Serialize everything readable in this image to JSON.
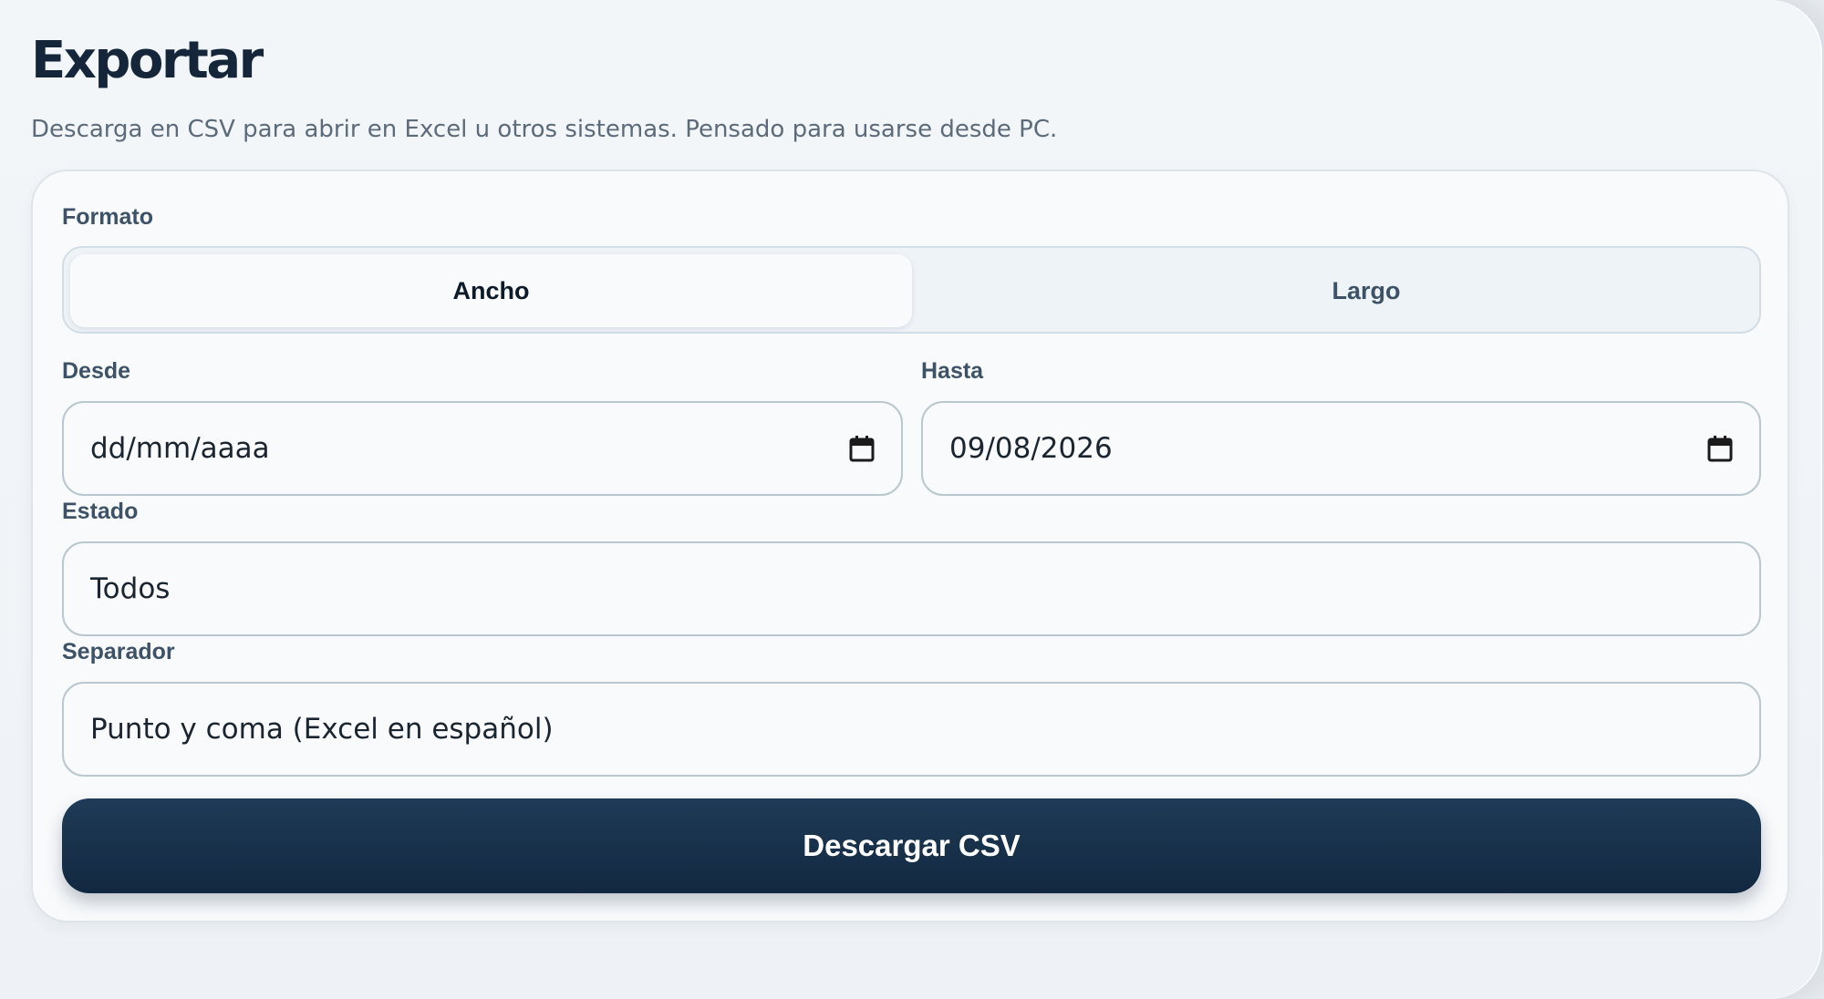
{
  "header": {
    "title": "Exportar",
    "subtitle": "Descarga en CSV para abrir en Excel u otros sistemas. Pensado para usarse desde PC."
  },
  "form": {
    "format": {
      "label": "Formato",
      "options": [
        "Ancho",
        "Largo"
      ],
      "selected": "Ancho"
    },
    "from": {
      "label": "Desde",
      "value": "dd/mm/aaaa",
      "icon": "calendar-icon"
    },
    "to": {
      "label": "Hasta",
      "value": "09/08/2026",
      "icon": "calendar-icon"
    },
    "status": {
      "label": "Estado",
      "value": "Todos"
    },
    "separator": {
      "label": "Separador",
      "value": "Punto y coma (Excel en español)"
    },
    "submit_label": "Descargar CSV"
  },
  "colors": {
    "primary_button": "#17314b",
    "background": "#eef2f6",
    "card": "#f8fafc",
    "border": "#b9c7cf"
  }
}
